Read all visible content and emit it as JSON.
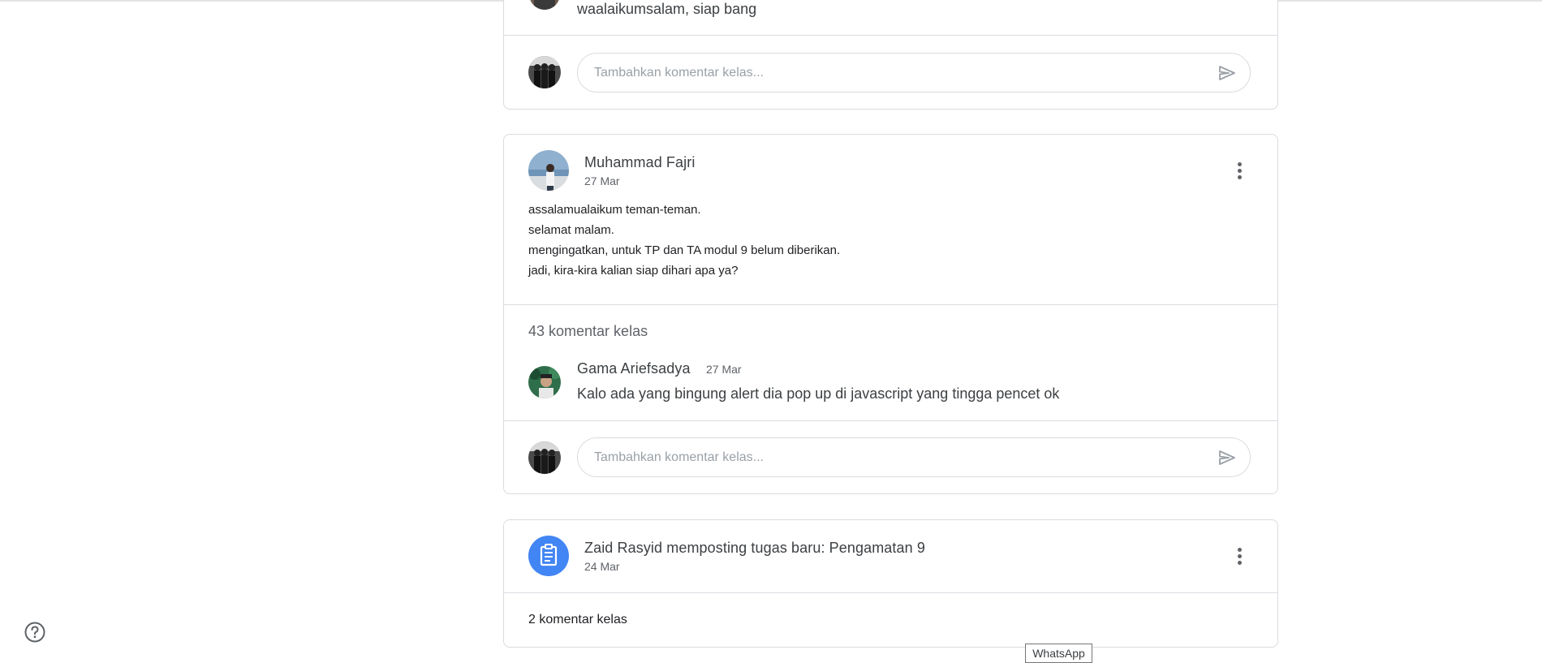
{
  "top_card": {
    "partial_comment_text": "waalaikumsalam, siap bang",
    "reply_placeholder": "Tambahkan komentar kelas..."
  },
  "post": {
    "author": "Muhammad Fajri",
    "date": "27 Mar",
    "lines": [
      "assalamualaikum teman-teman.",
      "selamat malam.",
      "mengingatkan, untuk TP dan TA modul 9 belum diberikan.",
      "jadi, kira-kira kalian siap dihari apa ya?"
    ],
    "comment_count": "43 komentar kelas",
    "comment": {
      "author": "Gama Ariefsadya",
      "date": "27 Mar",
      "text": "Kalo ada yang bingung alert dia pop up di javascript yang tingga pencet ok"
    },
    "reply_placeholder": "Tambahkan komentar kelas..."
  },
  "assignment": {
    "title": "Zaid Rasyid memposting tugas baru: Pengamatan 9",
    "date": "24 Mar",
    "comment_count": "2 komentar kelas"
  },
  "tooltip": "WhatsApp",
  "icons": {
    "help": "help-circle-icon",
    "send": "send-icon",
    "more": "more-vert-icon",
    "assignment": "assignment-icon"
  },
  "colors": {
    "accent": "#4285f4",
    "border": "#dadce0",
    "icon_grey": "#5f6368"
  }
}
